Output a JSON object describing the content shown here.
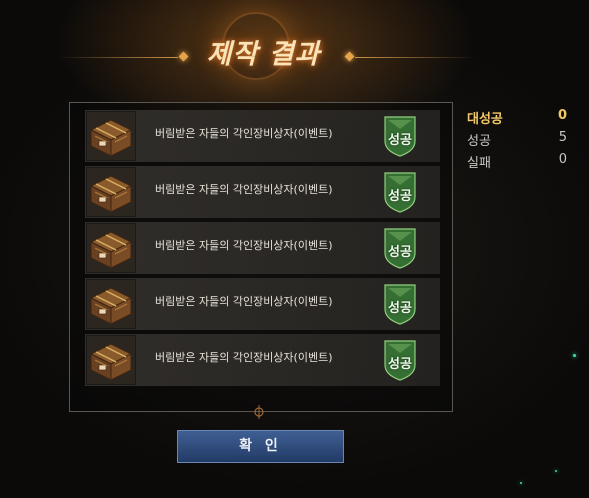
{
  "dialog": {
    "title": "제작 결과",
    "items": [
      {
        "name": "버림받은 자들의 각인장비상자(이벤트)",
        "result": "성공",
        "icon": "treasure-chest-icon"
      },
      {
        "name": "버림받은 자들의 각인장비상자(이벤트)",
        "result": "성공",
        "icon": "treasure-chest-icon"
      },
      {
        "name": "버림받은 자들의 각인장비상자(이벤트)",
        "result": "성공",
        "icon": "treasure-chest-icon"
      },
      {
        "name": "버림받은 자들의 각인장비상자(이벤트)",
        "result": "성공",
        "icon": "treasure-chest-icon"
      },
      {
        "name": "버림받은 자들의 각인장비상자(이벤트)",
        "result": "성공",
        "icon": "treasure-chest-icon"
      }
    ],
    "stats": [
      {
        "label": "대성공",
        "value": "0"
      },
      {
        "label": "성공",
        "value": "5"
      },
      {
        "label": "실패",
        "value": "0"
      }
    ],
    "confirm_label": "확 인"
  },
  "colors": {
    "title_glow": "#d7782c",
    "success_badge": "#3f8a3c",
    "great_success_text": "#f4c866",
    "button": "#2f4d80"
  }
}
